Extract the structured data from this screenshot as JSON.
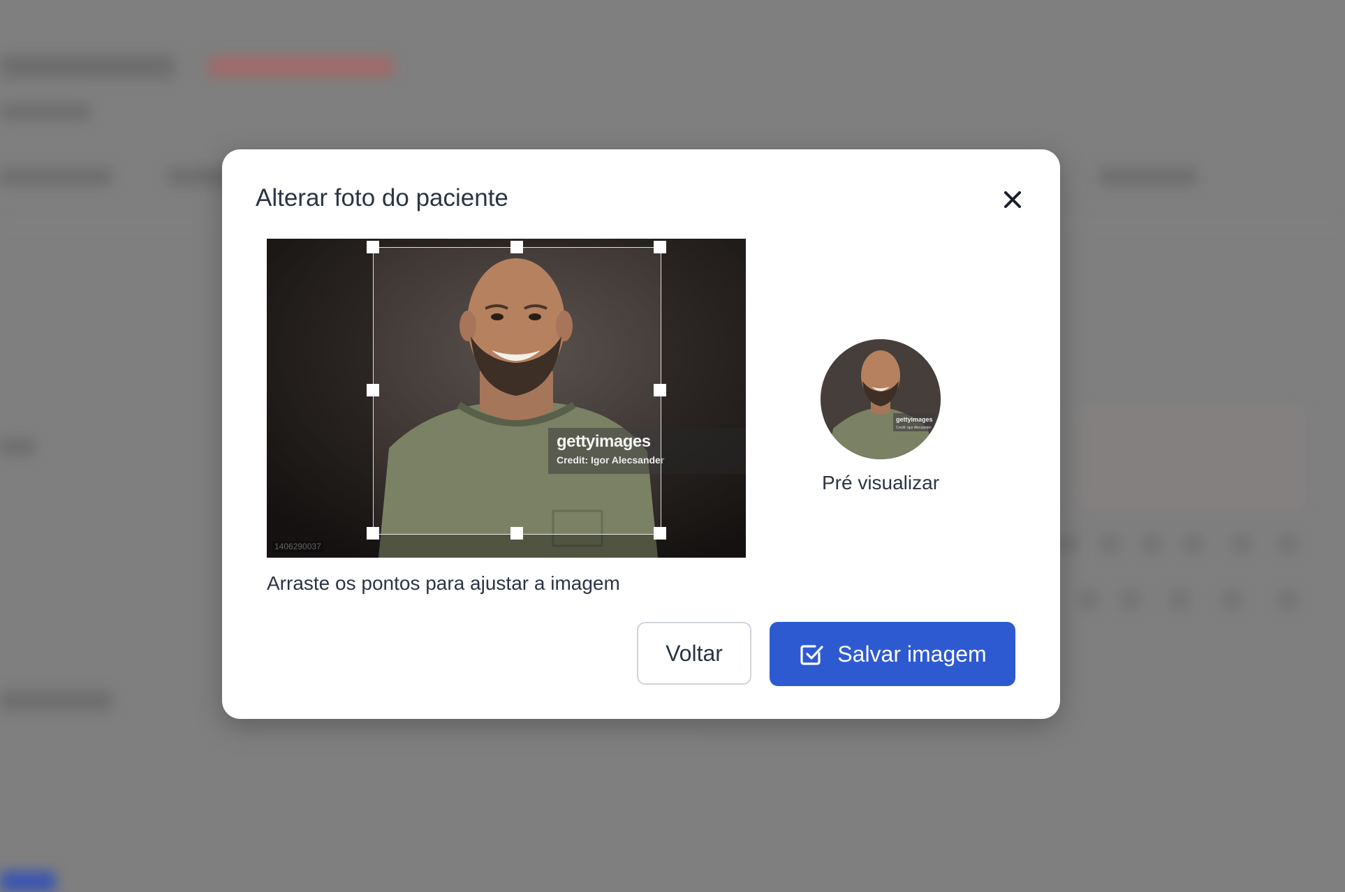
{
  "modal": {
    "title": "Alterar foto do paciente",
    "close_icon": "close-icon",
    "hint": "Arraste os pontos para ajustar a imagem",
    "preview_label": "Pré visualizar",
    "back_label": "Voltar",
    "save_label": "Salvar imagem",
    "save_icon": "check-square-icon",
    "photo": {
      "watermark_logo": "gettyimages",
      "watermark_credit": "Credit: Igor Alecsander",
      "photo_id": "1406290037"
    }
  },
  "colors": {
    "primary": "#2e5ad1",
    "text": "#2c3443",
    "overlay": "#7f7f7f"
  }
}
